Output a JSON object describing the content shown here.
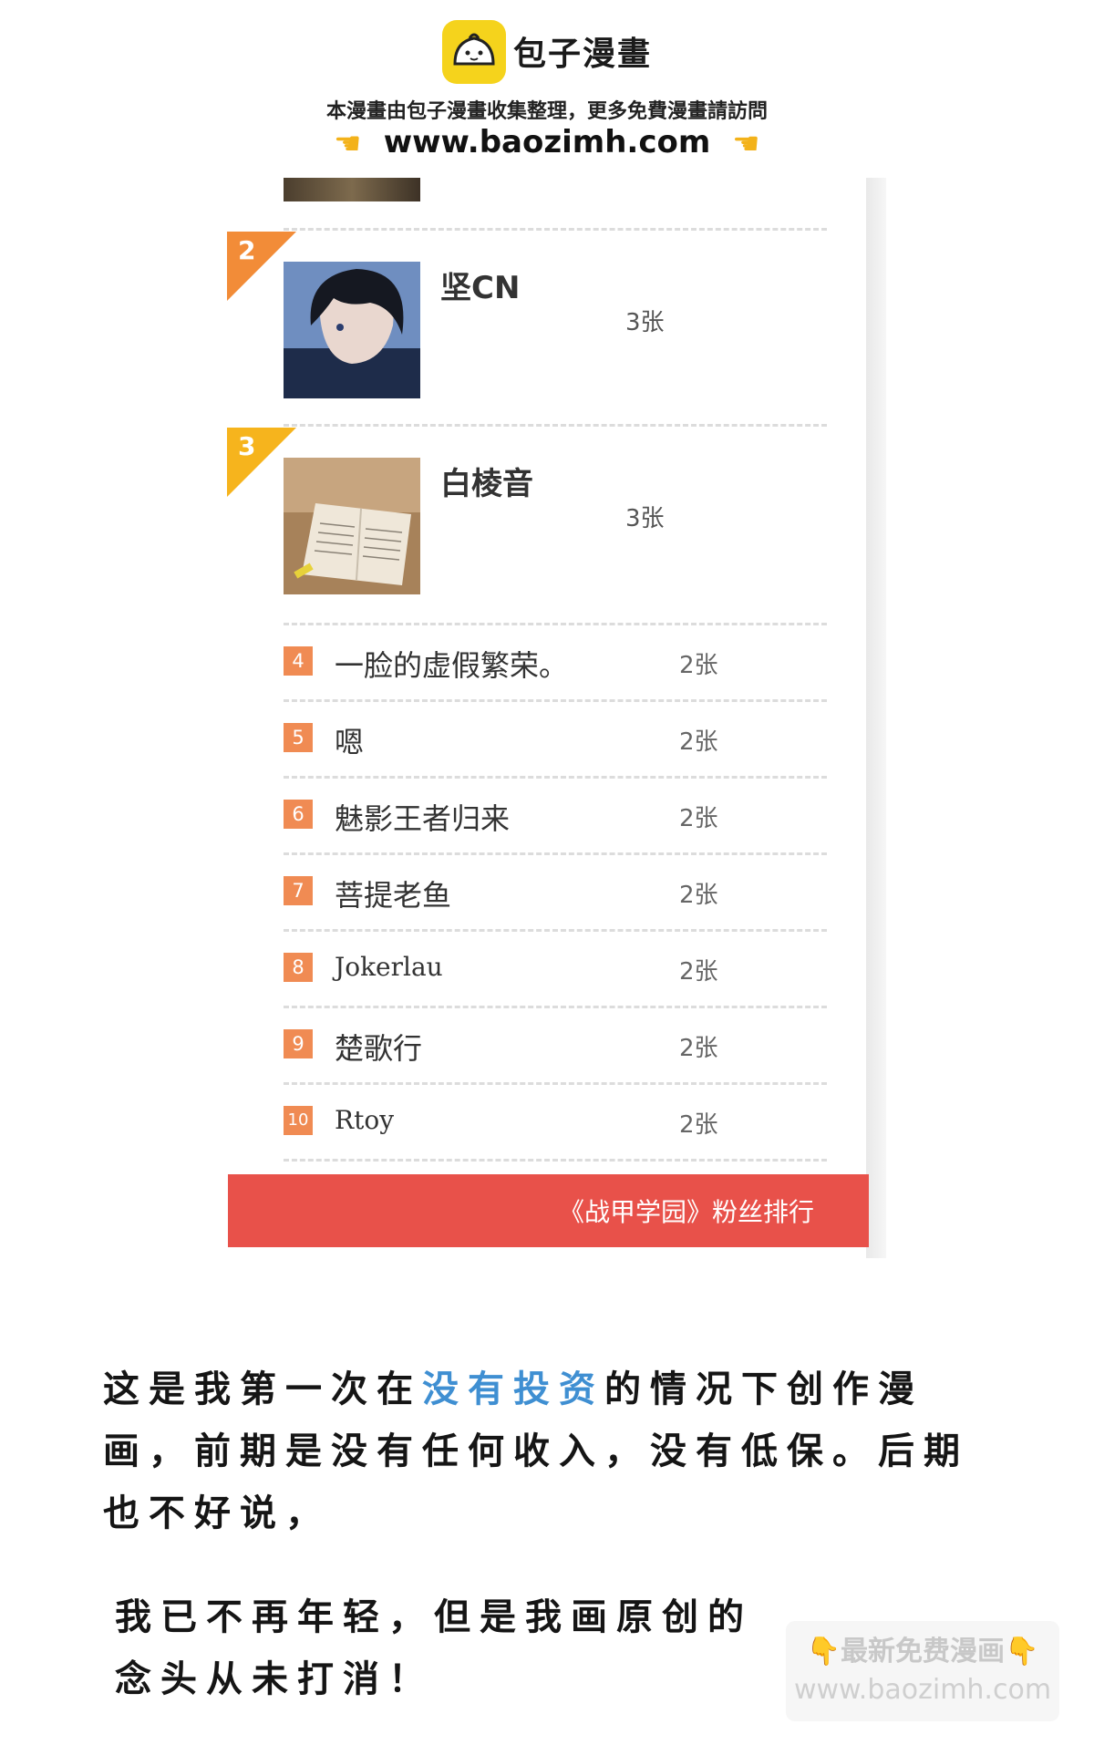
{
  "watermark": {
    "brand": "包子漫畫",
    "notice": "本漫畫由包子漫畫收集整理，更多免費漫畫請訪問",
    "url": "www.baozimh.com",
    "stamp_line1": "最新免费漫画",
    "stamp_line2": "www.baozimh.com"
  },
  "ranking": {
    "top": [
      {
        "rank": "2",
        "name": "坚CN",
        "count": "3张"
      },
      {
        "rank": "3",
        "name": "白棱音",
        "count": "3张"
      }
    ],
    "rows": [
      {
        "rank": "4",
        "name": "一脸的虚假繁荣。",
        "count": "2张"
      },
      {
        "rank": "5",
        "name": "嗯",
        "count": "2张"
      },
      {
        "rank": "6",
        "name": "魅影王者归来",
        "count": "2张"
      },
      {
        "rank": "7",
        "name": "菩提老鱼",
        "count": "2张"
      },
      {
        "rank": "8",
        "name": "Jokerlau",
        "count": "2张"
      },
      {
        "rank": "9",
        "name": "楚歌行",
        "count": "2张"
      },
      {
        "rank": "10",
        "name": "Rtoy",
        "count": "2张"
      }
    ],
    "footer": "《战甲学园》粉丝排行",
    "colors": {
      "ribbon2": "#f28c38",
      "ribbon3": "#f6b41d",
      "badge": "#f08b53",
      "bar": "#e8514a"
    }
  },
  "text": {
    "p1_a": "这是我第一次在",
    "p1_hl": "没有投资",
    "p1_b": "的情况下创作漫画，前期是没有任何收入，没有低保。后期也不好说，",
    "p2": "我已不再年轻，但是我画原创的念头从未打消！"
  }
}
